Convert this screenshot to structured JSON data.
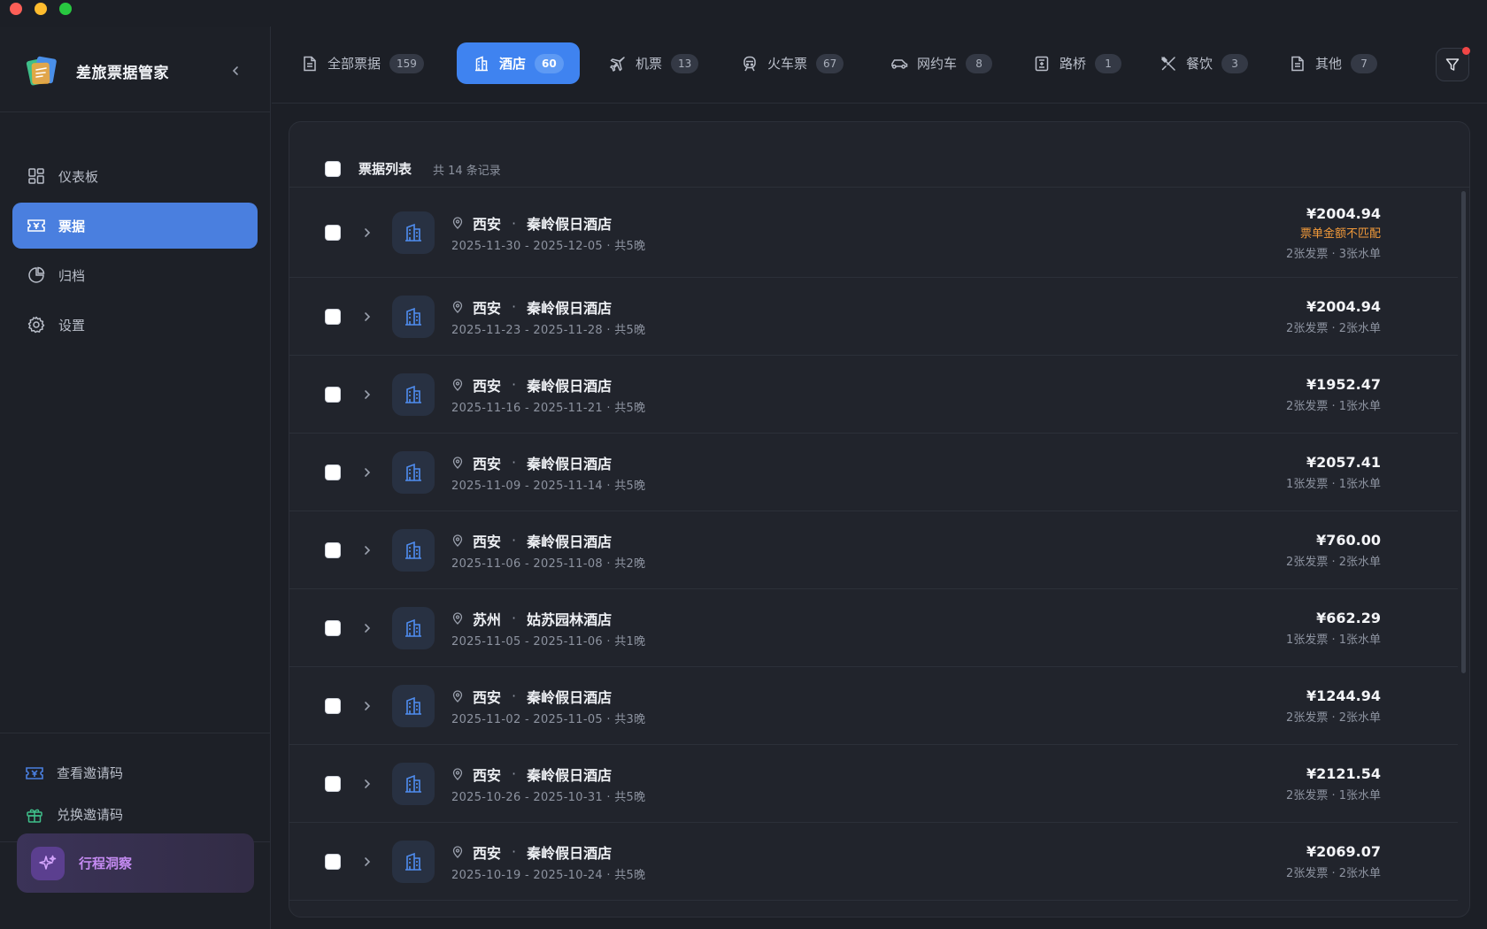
{
  "app": {
    "name": "差旅票据管家"
  },
  "sidebar": {
    "nav": [
      {
        "label": "仪表板",
        "icon": "dashboard-icon",
        "active": false
      },
      {
        "label": "票据",
        "icon": "ticket-icon",
        "active": true
      },
      {
        "label": "归档",
        "icon": "pie-chart-icon",
        "active": false
      },
      {
        "label": "设置",
        "icon": "gear-icon",
        "active": false
      }
    ],
    "bottom_links": [
      {
        "label": "查看邀请码",
        "icon": "ticket-icon",
        "color": "#4a7fdf"
      },
      {
        "label": "兑换邀请码",
        "icon": "gift-icon",
        "color": "#3fbf8a"
      }
    ],
    "insight": {
      "label": "行程洞察",
      "icon": "sparkle-icon"
    }
  },
  "tabs": [
    {
      "label": "全部票据",
      "count": "159",
      "icon": "document-icon",
      "active": false
    },
    {
      "label": "酒店",
      "count": "60",
      "icon": "hotel-icon",
      "active": true
    },
    {
      "label": "机票",
      "count": "13",
      "icon": "plane-icon",
      "active": false
    },
    {
      "label": "火车票",
      "count": "67",
      "icon": "train-icon",
      "active": false
    },
    {
      "label": "网约车",
      "count": "8",
      "icon": "car-icon",
      "active": false
    },
    {
      "label": "路桥",
      "count": "1",
      "icon": "toll-icon",
      "active": false
    },
    {
      "label": "餐饮",
      "count": "3",
      "icon": "dining-icon",
      "active": false
    },
    {
      "label": "其他",
      "count": "7",
      "icon": "document-icon",
      "active": false
    }
  ],
  "list": {
    "title": "票据列表",
    "count_text": "共 14 条记录",
    "rows": [
      {
        "city": "西安",
        "hotel": "秦岭假日酒店",
        "dates": "2025-11-30 - 2025-12-05 · 共5晚",
        "amount": "¥2004.94",
        "warning": "票单金额不匹配",
        "docs": "2张发票 · 3张水单"
      },
      {
        "city": "西安",
        "hotel": "秦岭假日酒店",
        "dates": "2025-11-23 - 2025-11-28 · 共5晚",
        "amount": "¥2004.94",
        "warning": "",
        "docs": "2张发票 · 2张水单"
      },
      {
        "city": "西安",
        "hotel": "秦岭假日酒店",
        "dates": "2025-11-16 - 2025-11-21 · 共5晚",
        "amount": "¥1952.47",
        "warning": "",
        "docs": "2张发票 · 1张水单"
      },
      {
        "city": "西安",
        "hotel": "秦岭假日酒店",
        "dates": "2025-11-09 - 2025-11-14 · 共5晚",
        "amount": "¥2057.41",
        "warning": "",
        "docs": "1张发票 · 1张水单"
      },
      {
        "city": "西安",
        "hotel": "秦岭假日酒店",
        "dates": "2025-11-06 - 2025-11-08 · 共2晚",
        "amount": "¥760.00",
        "warning": "",
        "docs": "2张发票 · 2张水单"
      },
      {
        "city": "苏州",
        "hotel": "姑苏园林酒店",
        "dates": "2025-11-05 - 2025-11-06 · 共1晚",
        "amount": "¥662.29",
        "warning": "",
        "docs": "1张发票 · 1张水单"
      },
      {
        "city": "西安",
        "hotel": "秦岭假日酒店",
        "dates": "2025-11-02 - 2025-11-05 · 共3晚",
        "amount": "¥1244.94",
        "warning": "",
        "docs": "2张发票 · 2张水单"
      },
      {
        "city": "西安",
        "hotel": "秦岭假日酒店",
        "dates": "2025-10-26 - 2025-10-31 · 共5晚",
        "amount": "¥2121.54",
        "warning": "",
        "docs": "2张发票 · 1张水单"
      },
      {
        "city": "西安",
        "hotel": "秦岭假日酒店",
        "dates": "2025-10-19 - 2025-10-24 · 共5晚",
        "amount": "¥2069.07",
        "warning": "",
        "docs": "2张发票 · 2张水单"
      }
    ]
  },
  "colors": {
    "accent": "#3f83f0",
    "sidebar_active": "#4a7fdf",
    "warning": "#f29a3a",
    "notification": "#f04646"
  }
}
